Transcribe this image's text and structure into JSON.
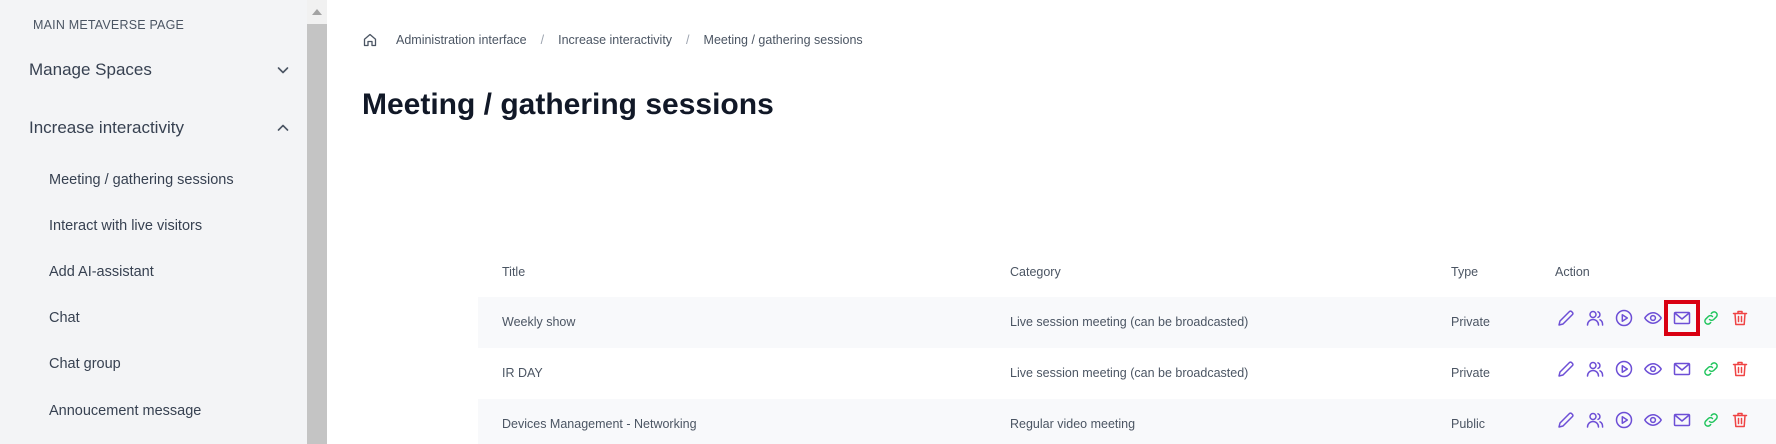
{
  "sidebar": {
    "heading": "MAIN METAVERSE PAGE",
    "groups": [
      {
        "label": "Manage Spaces",
        "expanded": false
      },
      {
        "label": "Increase interactivity",
        "expanded": true
      }
    ],
    "items": [
      {
        "label": "Meeting / gathering sessions"
      },
      {
        "label": "Interact with live visitors"
      },
      {
        "label": "Add AI-assistant"
      },
      {
        "label": "Chat"
      },
      {
        "label": "Chat group"
      },
      {
        "label": "Annoucement message"
      }
    ]
  },
  "breadcrumb": {
    "icon": "home-icon",
    "items": [
      "Administration interface",
      "Increase interactivity",
      "Meeting / gathering sessions"
    ],
    "separator": "/"
  },
  "page": {
    "title": "Meeting / gathering sessions"
  },
  "table": {
    "columns": [
      "Title",
      "Category",
      "Type",
      "Action"
    ],
    "rows": [
      {
        "title": "Weekly show",
        "category": "Live session meeting (can be broadcasted)",
        "type": "Private"
      },
      {
        "title": "IR DAY",
        "category": "Live session meeting (can be broadcasted)",
        "type": "Private"
      },
      {
        "title": "Devices Management - Networking",
        "category": "Regular video meeting",
        "type": "Public"
      }
    ],
    "action_icons": [
      "edit-icon",
      "participants-icon",
      "play-icon",
      "view-icon",
      "mail-icon",
      "link-icon",
      "delete-icon"
    ],
    "highlighted_action": {
      "row": 0,
      "icon": "mail-icon"
    }
  },
  "colors": {
    "accent": "#6d4fd6",
    "link_green": "#22c55e",
    "delete_red": "#ef4444",
    "highlight_border": "#d90012",
    "sidebar_bg": "#f3f4f6"
  }
}
